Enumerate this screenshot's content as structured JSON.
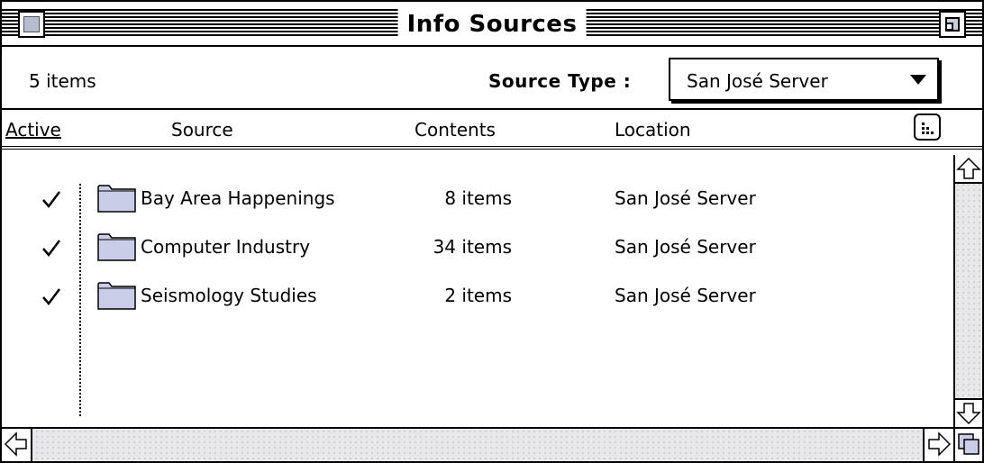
{
  "window": {
    "title": "Info Sources"
  },
  "info_bar": {
    "item_count": "5 items",
    "source_type_label": "Source Type :",
    "source_type_value": "San José Server"
  },
  "columns": {
    "active": "Active",
    "source": "Source",
    "contents": "Contents",
    "location": "Location"
  },
  "rows": [
    {
      "active": true,
      "source": "Bay  Area Happenings",
      "contents": "8 items",
      "location": "San José Server"
    },
    {
      "active": true,
      "source": "Computer Industry",
      "contents": "34 items",
      "location": "San José Server"
    },
    {
      "active": true,
      "source": "Seismology Studies",
      "contents": "2 items",
      "location": "San José Server"
    }
  ],
  "icons": {
    "close": "close-box-icon",
    "zoom": "zoom-box-icon",
    "folder": "folder-icon",
    "check": "checkmark-icon",
    "column_options": "column-options-icon",
    "scroll_up": "scroll-up-arrow-icon",
    "scroll_down": "scroll-down-arrow-icon",
    "scroll_left": "scroll-left-arrow-icon",
    "scroll_right": "scroll-right-arrow-icon",
    "grow": "grow-box-icon"
  },
  "colors": {
    "folder_fill": "#c9cde8",
    "scroll_track": "#e8e8ec"
  }
}
